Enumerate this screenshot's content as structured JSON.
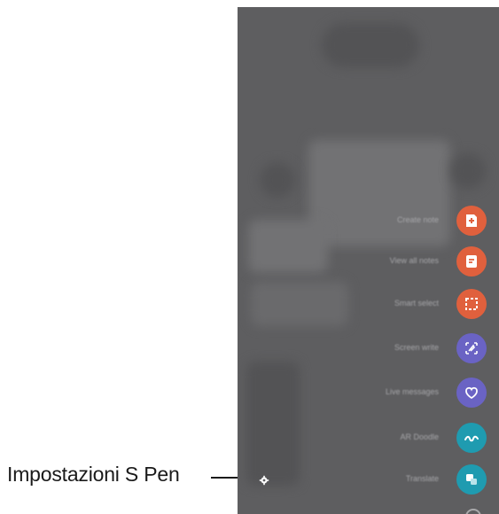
{
  "annotation": {
    "label": "Impostazioni S Pen"
  },
  "air_command": {
    "items": [
      {
        "id": "create-note",
        "label": "Create note",
        "icon": "note-plus-icon",
        "color": "#e0603d"
      },
      {
        "id": "view-all-notes",
        "label": "View all notes",
        "icon": "notes-list-icon",
        "color": "#e0603d"
      },
      {
        "id": "smart-select",
        "label": "Smart select",
        "icon": "smart-select-icon",
        "color": "#e0603d"
      },
      {
        "id": "screen-write",
        "label": "Screen write",
        "icon": "screen-write-icon",
        "color": "#6a63c4"
      },
      {
        "id": "live-messages",
        "label": "Live messages",
        "icon": "heart-message-icon",
        "color": "#6a63c4"
      },
      {
        "id": "ar-doodle",
        "label": "AR Doodle",
        "icon": "ar-doodle-icon",
        "color": "#1f9bb0"
      },
      {
        "id": "translate",
        "label": "Translate",
        "icon": "translate-icon",
        "color": "#1f9bb0"
      }
    ],
    "settings_icon": "gear-icon"
  }
}
